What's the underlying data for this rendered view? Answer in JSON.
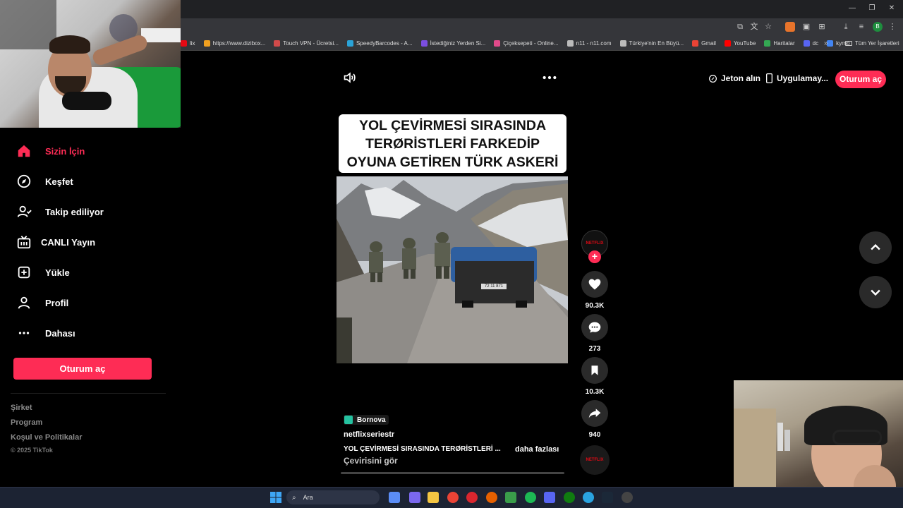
{
  "browser": {
    "bookmarks": [
      {
        "label": "lix",
        "color": "#e50914"
      },
      {
        "label": "https://www.dizibox...",
        "color": "#f0a020"
      },
      {
        "label": "Touch VPN - Ücretsi...",
        "color": "#d04a4a"
      },
      {
        "label": "SpeedyBarcodes - A...",
        "color": "#2aa3d8"
      },
      {
        "label": "İstediğiniz Yerden Si...",
        "color": "#7b4ee0"
      },
      {
        "label": "Çiçeksepeti - Online...",
        "color": "#e04a8a"
      },
      {
        "label": "n11 - n11.com",
        "color": "#bbbbbb"
      },
      {
        "label": "Türkiye'nin En Büyü...",
        "color": "#bbbbbb"
      },
      {
        "label": "Gmail",
        "color": "#ea4335"
      },
      {
        "label": "YouTube",
        "color": "#ff0000"
      },
      {
        "label": "Haritalar",
        "color": "#34a853"
      },
      {
        "label": "dc",
        "color": "#5865f2"
      },
      {
        "label": "kyrrio",
        "color": "#4285f4"
      }
    ],
    "bookmarks_overflow": "»",
    "all_bookmarks_label": "Tüm Yer İşaretleri",
    "profile_initial": "B"
  },
  "sidebar": {
    "items": [
      {
        "label": "Sizin İçin",
        "icon": "home-icon"
      },
      {
        "label": "Keşfet",
        "icon": "compass-icon"
      },
      {
        "label": "Takip ediliyor",
        "icon": "following-icon"
      },
      {
        "label": "CANLI Yayın",
        "icon": "live-icon"
      },
      {
        "label": "Yükle",
        "icon": "upload-icon"
      },
      {
        "label": "Profil",
        "icon": "profile-icon"
      },
      {
        "label": "Dahası",
        "icon": "more-icon"
      }
    ],
    "login_label": "Oturum aç",
    "footer": [
      "Şirket",
      "Program",
      "Koşul ve Politikalar"
    ],
    "copyright": "© 2025 TikTok"
  },
  "header": {
    "coins_label": "Jeton alın",
    "app_label": "Uygulamay...",
    "login_label": "Oturum aç"
  },
  "video": {
    "caption_lines": [
      "YOL ÇEVİRMESİ SIRASINDA",
      "TERØRİSTLERİ FARKEDİP",
      "OYUNA GETİREN TÜRK ASKERİ"
    ],
    "plate_text": "72 11 871",
    "location": "Bornova",
    "username": "netflixseriestr",
    "description": "YOL ÇEVİRMESİ SIRASINDA TERØRİSTLERİ ...",
    "more_label": "daha fazlası",
    "translate_label": "Çevirisini gör",
    "progress": 0
  },
  "actions": {
    "avatar_text": "NETFLIX",
    "likes": "90.3K",
    "comments": "273",
    "saves": "10.3K",
    "shares": "940",
    "music_text": "NETFLIX"
  },
  "taskbar": {
    "search_placeholder": "Ara"
  },
  "colors": {
    "accent": "#fe2c55",
    "background": "#000000"
  }
}
